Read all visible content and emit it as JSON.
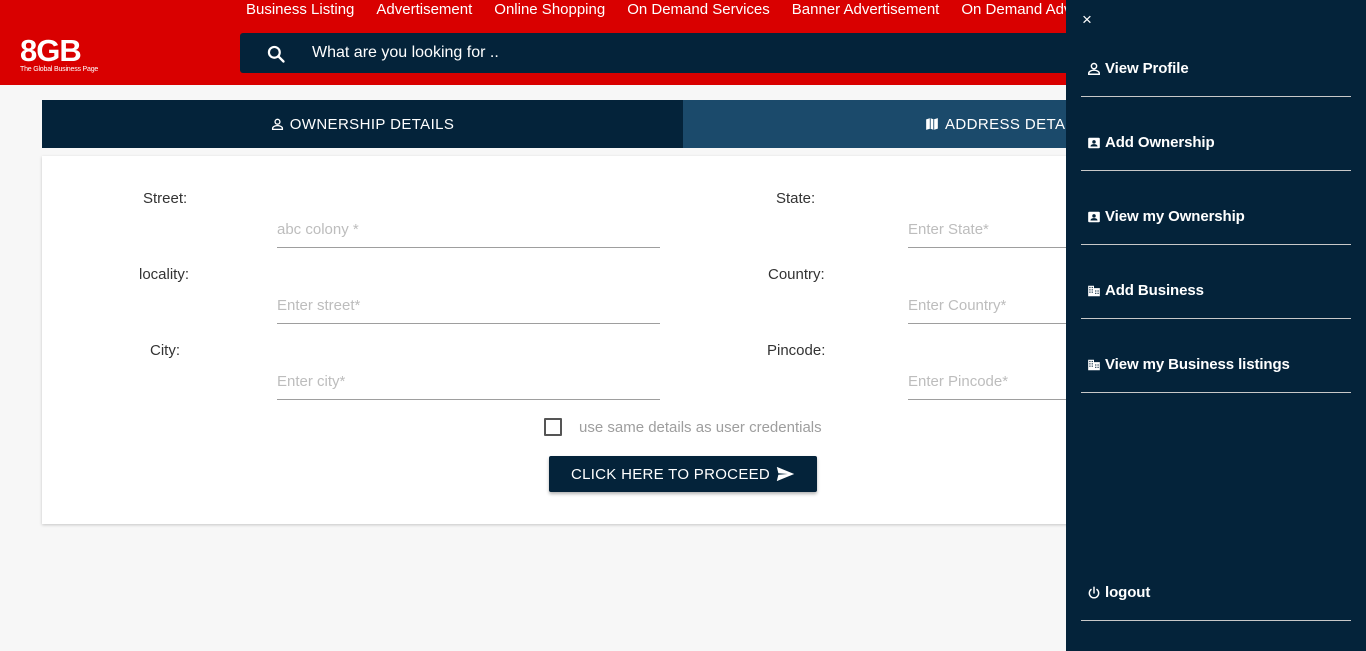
{
  "header": {
    "logo_main": "8GB",
    "logo_sub": "The Global Business Page",
    "nav": [
      "Business Listing",
      "Advertisement",
      "Online Shopping",
      "On Demand Services",
      "Banner Advertisement",
      "On Demand Adv"
    ],
    "search_placeholder": "What are you looking for .."
  },
  "tabs": {
    "ownership": "OWNERSHIP DETAILS",
    "address": "ADDRESS DETAI"
  },
  "form": {
    "street_label": "Street:",
    "street_placeholder": "abc colony *",
    "locality_label": "locality:",
    "locality_placeholder": "Enter street*",
    "city_label": "City:",
    "city_placeholder": "Enter city*",
    "state_label": "State:",
    "state_placeholder": "Enter State*",
    "country_label": "Country:",
    "country_placeholder": "Enter Country*",
    "pincode_label": "Pincode:",
    "pincode_placeholder": "Enter Pincode*",
    "same_details_label": "use same details as user credentials",
    "proceed_label": "CLICK HERE TO PROCEED"
  },
  "drawer": {
    "close": "×",
    "items": [
      {
        "label": "View Profile",
        "icon": "person-icon"
      },
      {
        "label": "Add Ownership",
        "icon": "contact-card-icon"
      },
      {
        "label": "View my Ownership",
        "icon": "contact-card-icon"
      },
      {
        "label": "Add Business",
        "icon": "building-icon"
      },
      {
        "label": "View my Business listings",
        "icon": "building-icon"
      }
    ],
    "logout": "logout"
  }
}
